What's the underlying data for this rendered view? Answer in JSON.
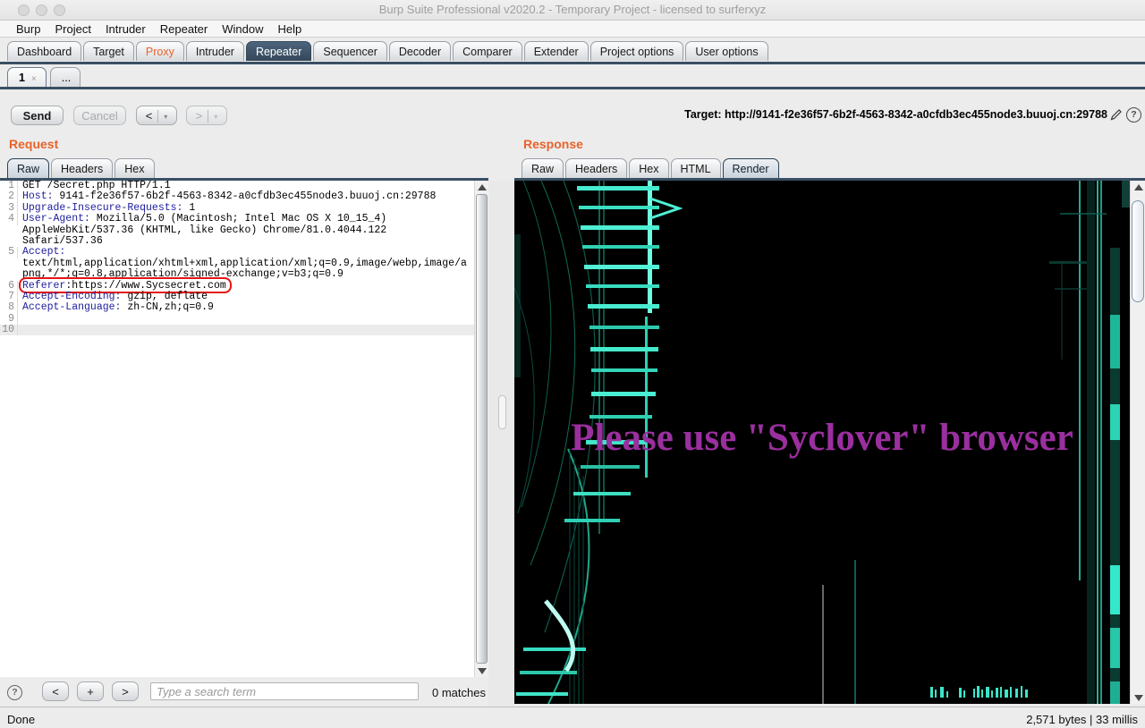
{
  "window": {
    "title": "Burp Suite Professional v2020.2 - Temporary Project - licensed to surferxyz"
  },
  "menu": {
    "items": [
      "Burp",
      "Project",
      "Intruder",
      "Repeater",
      "Window",
      "Help"
    ]
  },
  "main_tabs": [
    {
      "label": "Dashboard"
    },
    {
      "label": "Target"
    },
    {
      "label": "Proxy",
      "accent": true
    },
    {
      "label": "Intruder"
    },
    {
      "label": "Repeater",
      "selected": true
    },
    {
      "label": "Sequencer"
    },
    {
      "label": "Decoder"
    },
    {
      "label": "Comparer"
    },
    {
      "label": "Extender"
    },
    {
      "label": "Project options"
    },
    {
      "label": "User options"
    }
  ],
  "subtabs": [
    {
      "label": "1",
      "closable": true,
      "selected": true,
      "close_glyph": "×"
    },
    {
      "label": "..."
    }
  ],
  "toolbar": {
    "send_label": "Send",
    "cancel_label": "Cancel",
    "back_label": "<",
    "forward_label": ">",
    "caret_glyph": "▾",
    "target_label": "Target:",
    "target_url": "http://9141-f2e36f57-6b2f-4563-8342-a0cfdb3ec455node3.buuoj.cn:29788",
    "help_glyph": "?"
  },
  "request": {
    "title": "Request",
    "tabs": [
      {
        "label": "Raw",
        "selected": true
      },
      {
        "label": "Headers"
      },
      {
        "label": "Hex"
      }
    ],
    "editor": {
      "rows": [
        {
          "n": "1",
          "segs": [
            {
              "t": "GET /Secret.php HTTP/1.1",
              "c": "plain"
            }
          ]
        },
        {
          "n": "2",
          "segs": [
            {
              "t": "Host:",
              "c": "name"
            },
            {
              "t": " 9141-f2e36f57-6b2f-4563-8342-a0cfdb3ec455node3.buuoj.cn:29788",
              "c": "plain"
            }
          ]
        },
        {
          "n": "3",
          "segs": [
            {
              "t": "Upgrade-Insecure-Requests:",
              "c": "name"
            },
            {
              "t": " 1",
              "c": "plain"
            }
          ]
        },
        {
          "n": "4",
          "segs": [
            {
              "t": "User-Agent:",
              "c": "name"
            },
            {
              "t": " Mozilla/5.0 (Macintosh; Intel Mac OS X 10_15_4)",
              "c": "plain"
            }
          ]
        },
        {
          "n": "",
          "segs": [
            {
              "t": "AppleWebKit/537.36 (KHTML, like Gecko) Chrome/81.0.4044.122",
              "c": "plain"
            }
          ]
        },
        {
          "n": "",
          "segs": [
            {
              "t": "Safari/537.36",
              "c": "plain"
            }
          ]
        },
        {
          "n": "5",
          "segs": [
            {
              "t": "Accept:",
              "c": "name"
            }
          ]
        },
        {
          "n": "",
          "segs": [
            {
              "t": "text/html,application/xhtml+xml,application/xml;q=0.9,image/webp,image/a",
              "c": "plain"
            }
          ]
        },
        {
          "n": "",
          "segs": [
            {
              "t": "png,*/*;q=0.8,application/signed-exchange;v=b3;q=0.9",
              "c": "plain"
            }
          ]
        },
        {
          "n": "6",
          "boxed": true,
          "segs": [
            {
              "t": "Referer",
              "c": "name"
            },
            {
              "t": ":https://www.Sycsecret.com",
              "c": "plain"
            }
          ]
        },
        {
          "n": "7",
          "segs": [
            {
              "t": "Accept-Encoding:",
              "c": "name"
            },
            {
              "t": " gzip, deflate",
              "c": "plain"
            }
          ]
        },
        {
          "n": "8",
          "segs": [
            {
              "t": "Accept-Language:",
              "c": "name"
            },
            {
              "t": " zh-CN,zh;q=0.9",
              "c": "plain"
            }
          ]
        },
        {
          "n": "9",
          "segs": []
        },
        {
          "n": "10",
          "hl": true,
          "segs": []
        }
      ]
    }
  },
  "response": {
    "title": "Response",
    "tabs": [
      {
        "label": "Raw"
      },
      {
        "label": "Headers"
      },
      {
        "label": "Hex"
      },
      {
        "label": "HTML"
      },
      {
        "label": "Render",
        "selected": true
      }
    ],
    "render": {
      "message": "Please use \"Syclover\" browser"
    }
  },
  "search": {
    "prev_label": "<",
    "add_label": "+",
    "next_label": ">",
    "placeholder": "Type a search term",
    "matches": "0 matches",
    "help_glyph": "?"
  },
  "status": {
    "left": "Done",
    "right": "2,571 bytes | 33 millis"
  },
  "colors": {
    "accent_orange": "#e8632a",
    "selected_tab": "#3a4f63",
    "annotation_red": "#e41414",
    "message_magenta": "#9a2f9f",
    "glitch_cyan": "#35e2c6",
    "header_name_blue": "#1c1c9c"
  }
}
